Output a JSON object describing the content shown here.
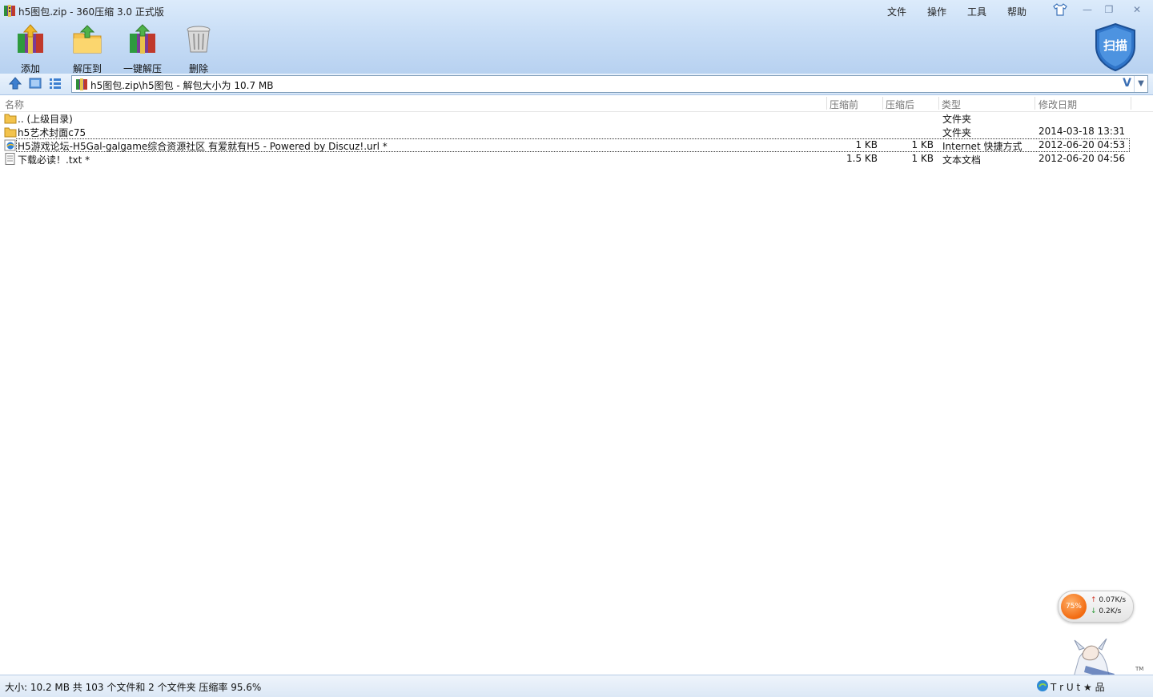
{
  "window": {
    "title": "h5图包.zip - 360压缩 3.0 正式版",
    "menu": [
      "文件",
      "操作",
      "工具",
      "帮助"
    ],
    "controls": {
      "minimize": "—",
      "restore": "❐",
      "close": "✕"
    }
  },
  "toolbar": {
    "add": "添加",
    "extract_to": "解压到",
    "one_click_extract": "一键解压",
    "delete": "删除",
    "scan": "扫描"
  },
  "address": {
    "path": "h5图包.zip\\h5图包 - 解包大小为 10.7 MB",
    "v_mark": "V",
    "dropdown": "▼"
  },
  "columns": {
    "name": "名称",
    "compressed_before": "压缩前",
    "compressed_after": "压缩后",
    "type": "类型",
    "modified": "修改日期"
  },
  "rows": [
    {
      "name": ".. (上级目录)",
      "size": "",
      "packed": "",
      "type": "文件夹",
      "date": "",
      "icon": "folder-icon"
    },
    {
      "name": "h5艺术封面c75",
      "size": "",
      "packed": "",
      "type": "文件夹",
      "date": "2014-03-18 13:31",
      "icon": "folder-icon"
    },
    {
      "name": "H5游戏论坛-H5Gal-galgame综合资源社区 有爱就有H5 - Powered by Discuz!.url *",
      "size": "1 KB",
      "packed": "1 KB",
      "type": "Internet 快捷方式",
      "date": "2012-06-20 04:53",
      "icon": "internet-shortcut-icon"
    },
    {
      "name": "下载必读！.txt *",
      "size": "1.5 KB",
      "packed": "1 KB",
      "type": "文本文档",
      "date": "2012-06-20 04:56",
      "icon": "text-file-icon"
    }
  ],
  "speed_widget": {
    "percent": "75%",
    "upload": "0.07K/s",
    "download": "0.2K/s"
  },
  "mascot": {
    "tm": "TM"
  },
  "status": {
    "text": "大小: 10.2 MB 共 103 个文件和 2 个文件夹 压缩率 95.6%",
    "brand": "T   r     U   t      ★ 品"
  },
  "colors": {
    "toolbar_top": "#dcebfb",
    "toolbar_bottom": "#b7d1f0",
    "shield_blue": "#2f74c8",
    "speed_orange": "#f26a10"
  }
}
